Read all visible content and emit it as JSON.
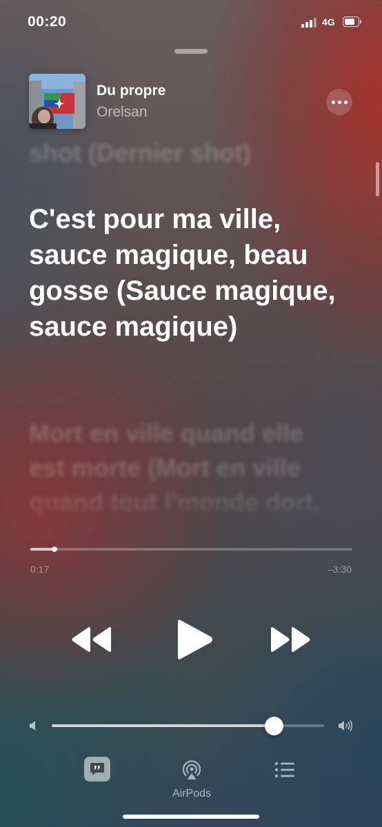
{
  "status_bar": {
    "time": "00:20",
    "network": "4G"
  },
  "now_playing": {
    "title": "Du propre",
    "artist": "Orelsan",
    "artwork_icon": "album-artwork"
  },
  "lyrics": {
    "previous": "shot (Dernier shot)",
    "current": "C'est pour ma ville, sauce magique, beau gosse (Sauce magique, sauce magique)",
    "next": "Mort en ville quand elle est morte (Mort en ville quand tout l'monde dort, okay)"
  },
  "playback": {
    "elapsed": "0:17",
    "remaining": "–3:30",
    "progress_fraction": 0.075,
    "state": "paused"
  },
  "volume": {
    "level_fraction": 0.814
  },
  "toolbar": {
    "airplay_label": "AirPods"
  },
  "colors": {
    "accent": "#ffffff",
    "bg_red": "#a8302a",
    "bg_teal": "#265054"
  }
}
